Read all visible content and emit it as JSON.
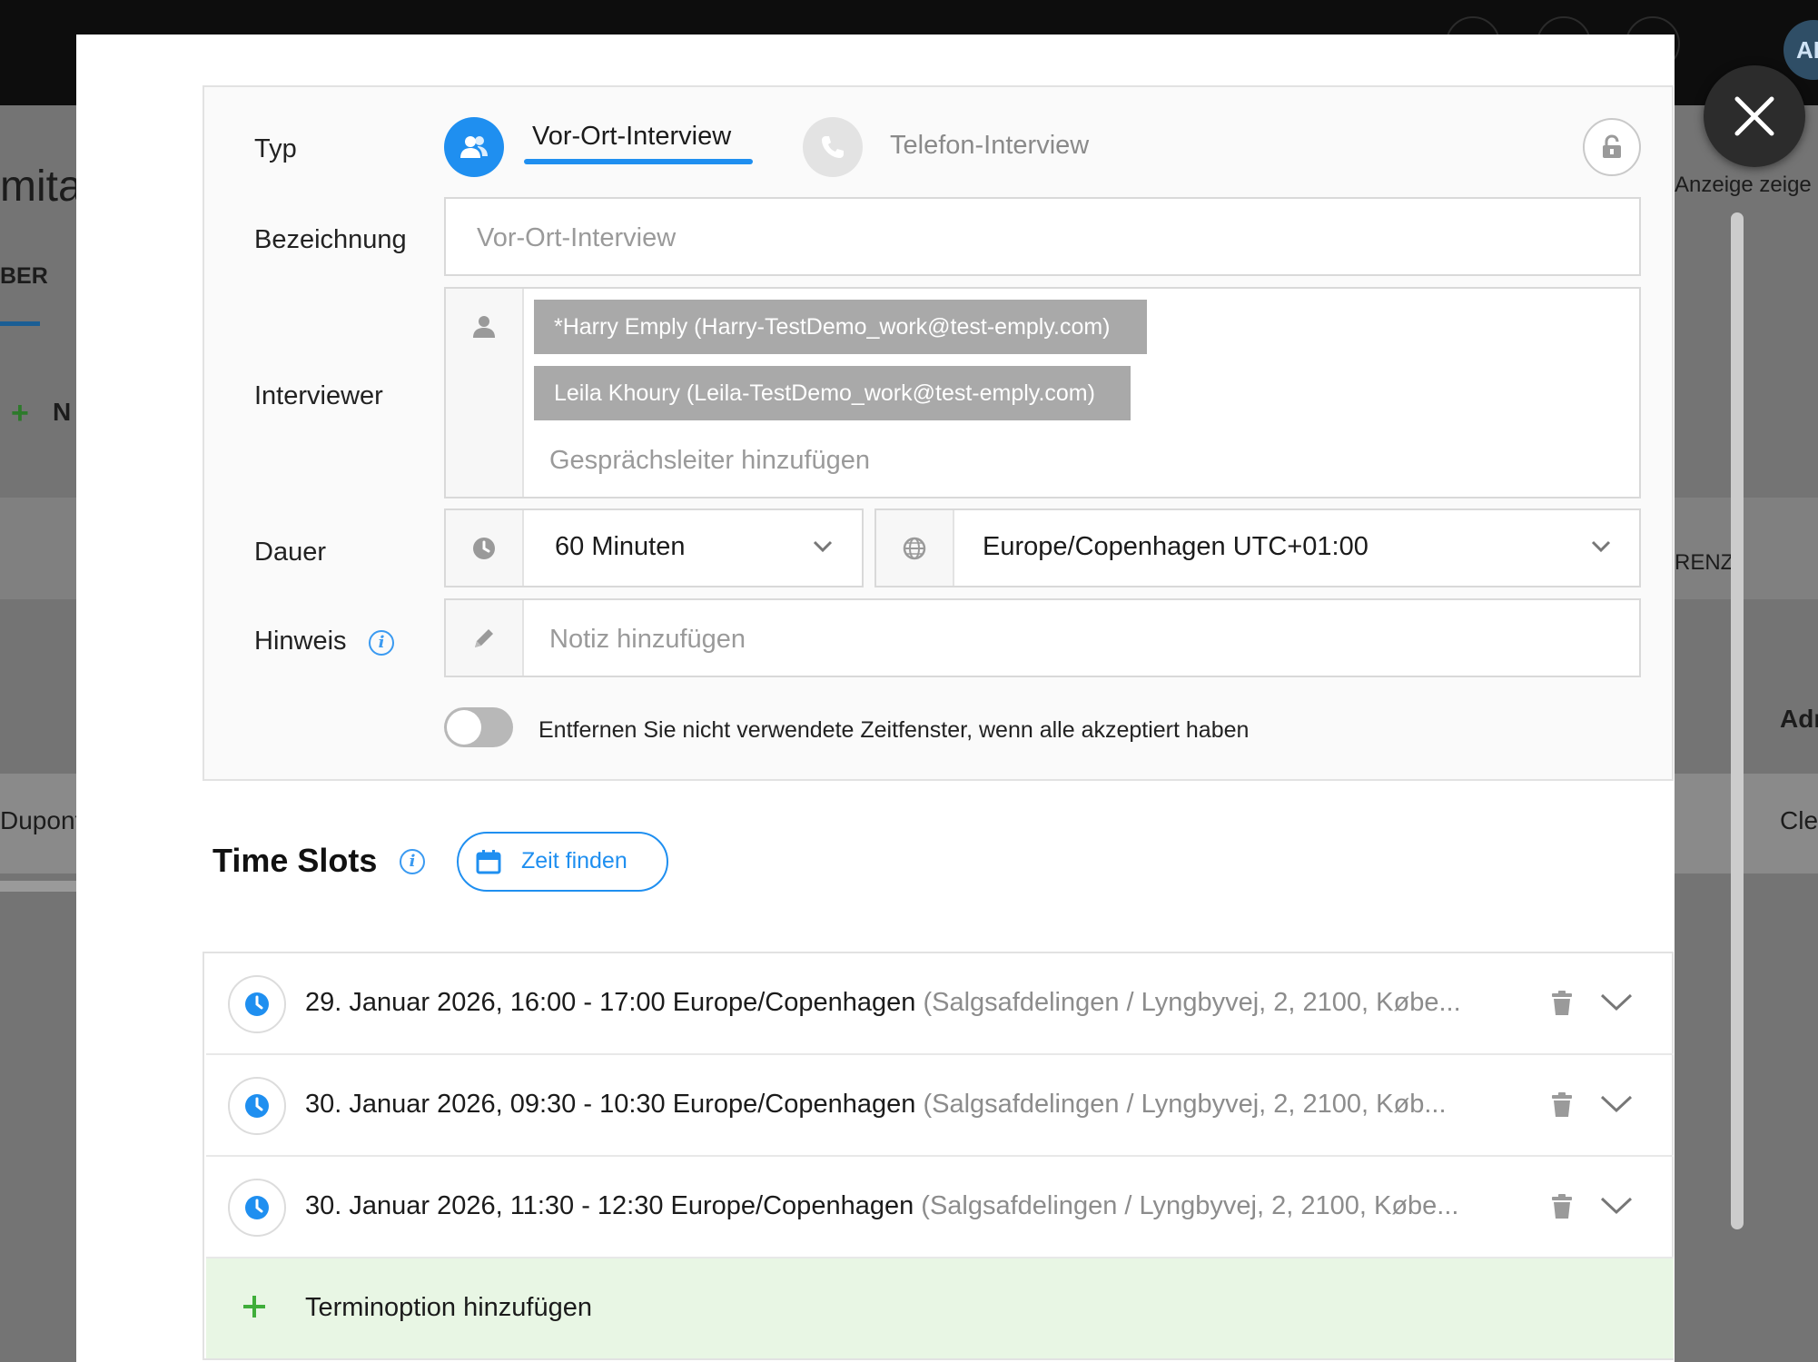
{
  "background": {
    "avatar_initials": "AI",
    "title_fragment": "mita",
    "tab_fragment": "BER",
    "new_fragment": "N",
    "anzeige_fragment": "Anzeige zeige",
    "renz_fragment": "RENZ",
    "adr_fragment": "Adr",
    "dupont_fragment": "Dupont",
    "cle_fragment": "Cle"
  },
  "modal": {
    "close_icon": "close-icon",
    "type": {
      "label": "Typ",
      "options": [
        {
          "label": "Vor-Ort-Interview",
          "icon": "people-icon",
          "active": true
        },
        {
          "label": "Telefon-Interview",
          "icon": "phone-icon",
          "active": false
        }
      ],
      "lock_icon": "unlock-icon"
    },
    "bezeichnung": {
      "label": "Bezeichnung",
      "placeholder": "Vor-Ort-Interview"
    },
    "interviewer": {
      "label": "Interviewer",
      "chips": [
        "*Harry Emply (Harry-TestDemo_work@test-emply.com)",
        "Leila Khoury (Leila-TestDemo_work@test-emply.com)"
      ],
      "placeholder": "Gesprächsleiter hinzufügen"
    },
    "dauer": {
      "label": "Dauer",
      "duration": "60 Minuten",
      "timezone": "Europe/Copenhagen UTC+01:00"
    },
    "hinweis": {
      "label": "Hinweis",
      "placeholder": "Notiz hinzufügen"
    },
    "toggle": {
      "label": "Entfernen Sie nicht verwendete Zeitfenster, wenn alle akzeptiert haben",
      "on": false
    },
    "time_slots": {
      "title": "Time Slots",
      "find_button": "Zeit finden",
      "slots": [
        {
          "main": "29. Januar 2026, 16:00 - 17:00 Europe/Copenhagen",
          "sub": "(Salgsafdelingen / Lyngbyvej, 2, 2100, Købe..."
        },
        {
          "main": "30. Januar 2026, 09:30 - 10:30 Europe/Copenhagen",
          "sub": "(Salgsafdelingen / Lyngbyvej, 2, 2100, Køb..."
        },
        {
          "main": "30. Januar 2026, 11:30 - 12:30 Europe/Copenhagen",
          "sub": "(Salgsafdelingen / Lyngbyvej, 2, 2100, Købe..."
        }
      ],
      "add_label": "Terminoption hinzufügen"
    },
    "colors": {
      "accent": "#1f8ff0",
      "chip": "#a9a9a9",
      "add_row": "#e8f6e4",
      "add_plus": "#3fae3a"
    }
  }
}
